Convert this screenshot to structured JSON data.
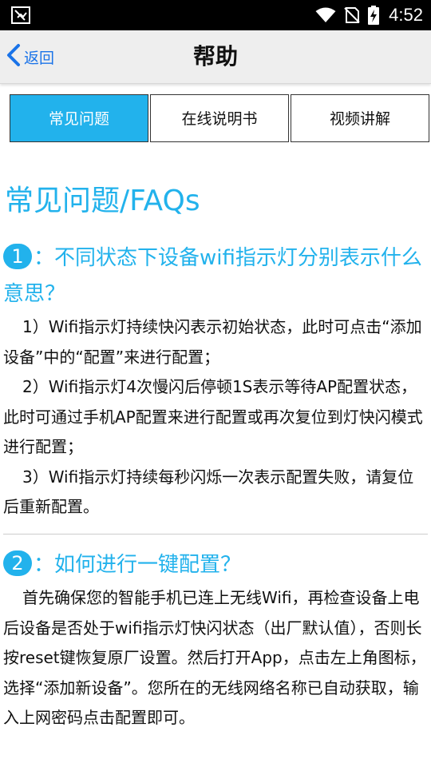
{
  "status_bar": {
    "time": "4:52",
    "icons": [
      "app-notification-icon",
      "wifi-icon",
      "no-sim-icon",
      "battery-charging-icon"
    ]
  },
  "app_bar": {
    "back_label": "返回",
    "title": "帮助"
  },
  "tabs": [
    {
      "label": "常见问题",
      "active": true
    },
    {
      "label": "在线说明书",
      "active": false
    },
    {
      "label": "视频讲解",
      "active": false
    }
  ],
  "faq": {
    "heading": "常见问题/FAQs",
    "items": [
      {
        "number": "1",
        "question": "：不同状态下设备wifi指示灯分别表示什么意思？",
        "answer": [
          "1）Wifi指示灯持续快闪表示初始状态，此时可点击“添加设备”中的“配置”来进行配置；",
          "2）Wifi指示灯4次慢闪后停顿1S表示等待AP配置状态，此时可通过手机AP配置来进行配置或再次复位到灯快闪模式进行配置；",
          "3）Wifi指示灯持续每秒闪烁一次表示配置失败，请复位后重新配置。"
        ]
      },
      {
        "number": "2",
        "question": "：如何进行一键配置？",
        "answer": [
          "首先确保您的智能手机已连上无线Wifi，再检查设备上电后设备是否处于wifi指示灯快闪状态（出厂默认值），否则长按reset键恢复原厂设置。然后打开App，点击左上角图标，选择“添加新设备”。您所在的无线网络名称已自动获取，输入上网密码点击配置即可。"
        ]
      }
    ]
  },
  "colors": {
    "accent": "#22b2ec",
    "link": "#1a73e8",
    "status_bar": "#000000",
    "app_bar": "#eeeeee"
  }
}
